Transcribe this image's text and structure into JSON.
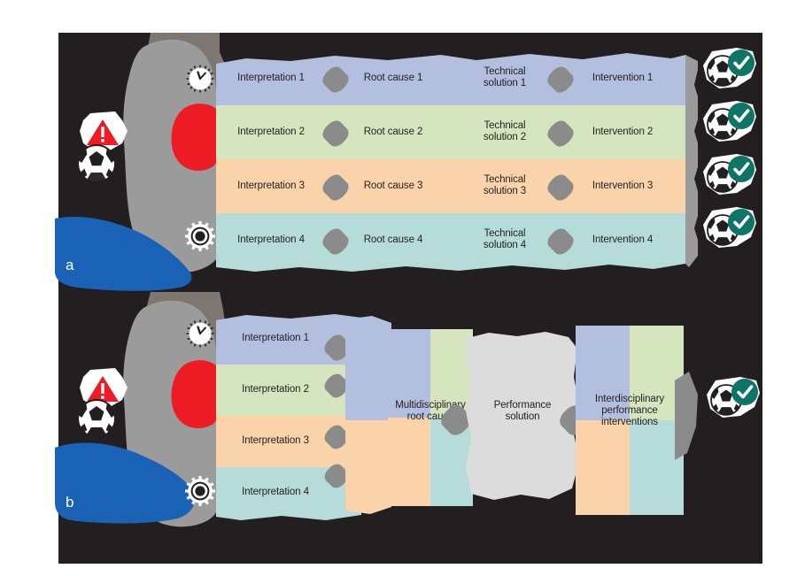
{
  "figure": {
    "background_color": "#231f20",
    "panels": [
      {
        "letter": "a",
        "rows": [
          {
            "color": "#b3bfdf",
            "cells": [
              "Interpretation 1",
              "Root cause 1",
              "Technical\nsolution 1",
              "Intervention 1"
            ]
          },
          {
            "color": "#d5e5bd",
            "cells": [
              "Interpretation 2",
              "Root cause 2",
              "Technical\nsolution 2",
              "Intervention 2"
            ]
          },
          {
            "color": "#fad3ab",
            "cells": [
              "Interpretation 3",
              "Root cause 3",
              "Technical\nsolution 3",
              "Intervention 3"
            ]
          },
          {
            "color": "#b5dcd9",
            "cells": [
              "Interpretation 4",
              "Root cause 4",
              "Technical\nsolution 4",
              "Intervention 4"
            ]
          }
        ],
        "left_icons": [
          "clock-icon",
          "warning-triangle-icon",
          "soccer-ball-icon",
          "gear-icon"
        ],
        "right_icons": [
          "soccer-ball-check-icon",
          "soccer-ball-check-icon",
          "soccer-ball-check-icon",
          "soccer-ball-check-icon"
        ]
      },
      {
        "letter": "b",
        "rows": [
          {
            "color": "#b3bfdf",
            "cells": [
              "Interpretation 1"
            ]
          },
          {
            "color": "#d5e5bd",
            "cells": [
              "Interpretation 2"
            ]
          },
          {
            "color": "#fad3ab",
            "cells": [
              "Interpretation 3"
            ]
          },
          {
            "color": "#b5dcd9",
            "cells": [
              "Interpretation 4"
            ]
          }
        ],
        "merged_blocks": [
          {
            "label": "Multidisciplinary\nroot cause",
            "style": "quad"
          },
          {
            "label": "Performance\nsolution",
            "style": "solid",
            "color": "#dcdcdc"
          },
          {
            "label": "Interdisciplinary\nperformance\ninterventions",
            "style": "quad"
          }
        ],
        "left_icons": [
          "clock-icon",
          "warning-triangle-icon",
          "soccer-ball-icon",
          "gear-icon"
        ],
        "right_icons": [
          "soccer-ball-check-icon"
        ]
      }
    ],
    "colors": {
      "row1": "#b3bfdf",
      "row2": "#d5e5bd",
      "row3": "#fad3ab",
      "row4": "#b5dcd9",
      "grey_blob_light": "#9b9b9b",
      "grey_blob_dark": "#7d7671",
      "diamond": "#8b8b8b",
      "red_stop": "#ed1c24",
      "blue_label": "#1a62b5",
      "check_teal": "#0e7566",
      "performance_grey": "#dcdcdc"
    }
  }
}
